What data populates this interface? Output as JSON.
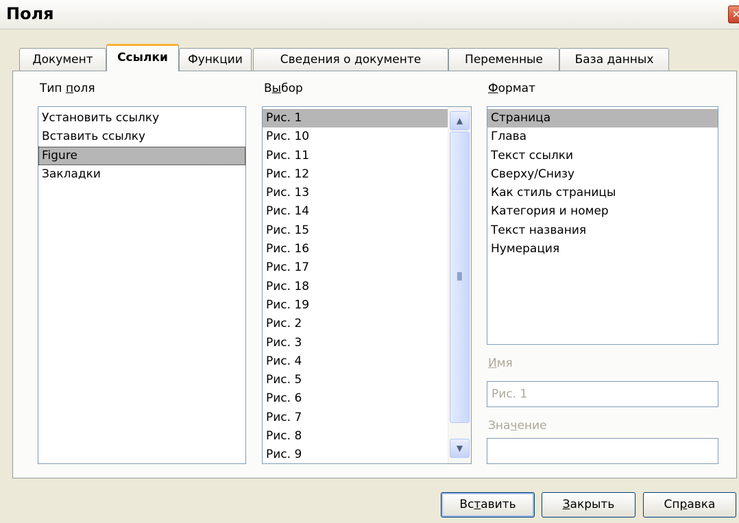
{
  "window": {
    "title": "Поля"
  },
  "tabs": [
    {
      "label": "Документ",
      "active": false
    },
    {
      "label": "Ссылки",
      "active": true
    },
    {
      "label": "Функции",
      "active": false
    },
    {
      "label": "Сведения о документе",
      "active": false
    },
    {
      "label": "Переменные",
      "active": false
    },
    {
      "label": "База данных",
      "active": false
    }
  ],
  "field_type": {
    "label_pre": "Тип ",
    "label_u": "п",
    "label_post": "оля",
    "items": [
      "Установить ссылку",
      "Вставить ссылку",
      "Figure",
      "Закладки"
    ],
    "selected": "Figure"
  },
  "selection": {
    "label_pre": "В",
    "label_u": "ы",
    "label_post": "бор",
    "items": [
      "Рис. 1",
      "Рис. 10",
      "Рис. 11",
      "Рис. 12",
      "Рис. 13",
      "Рис. 14",
      "Рис. 15",
      "Рис. 16",
      "Рис. 17",
      "Рис. 18",
      "Рис. 19",
      "Рис. 2",
      "Рис. 3",
      "Рис. 4",
      "Рис. 5",
      "Рис. 6",
      "Рис. 7",
      "Рис. 8",
      "Рис. 9"
    ],
    "selected": "Рис. 1"
  },
  "format": {
    "label_pre": "",
    "label_u": "Ф",
    "label_post": "ормат",
    "items": [
      "Страница",
      "Глава",
      "Текст ссылки",
      "Сверху/Снизу",
      "Как стиль страницы",
      "Категория и номер",
      "Текст названия",
      "Нумерация"
    ],
    "selected": "Страница"
  },
  "name": {
    "label_pre": "",
    "label_u": "И",
    "label_post": "мя",
    "value": "Рис. 1"
  },
  "value_field": {
    "label_pre": "Зна",
    "label_u": "ч",
    "label_post": "ение",
    "value": ""
  },
  "buttons": {
    "insert": {
      "pre": "Вс",
      "u": "т",
      "post": "авить"
    },
    "close": {
      "pre": "",
      "u": "З",
      "post": "акрыть"
    },
    "help": {
      "pre": "Сп",
      "u": "р",
      "post": "авка"
    }
  },
  "colors": {
    "tab_accent": "#f3b236",
    "selection_bg": "#b6b6b6",
    "border": "#7f9db9"
  },
  "icons": {
    "close": "close-icon",
    "scroll_up": "chevron-up-icon",
    "scroll_down": "chevron-down-icon"
  }
}
